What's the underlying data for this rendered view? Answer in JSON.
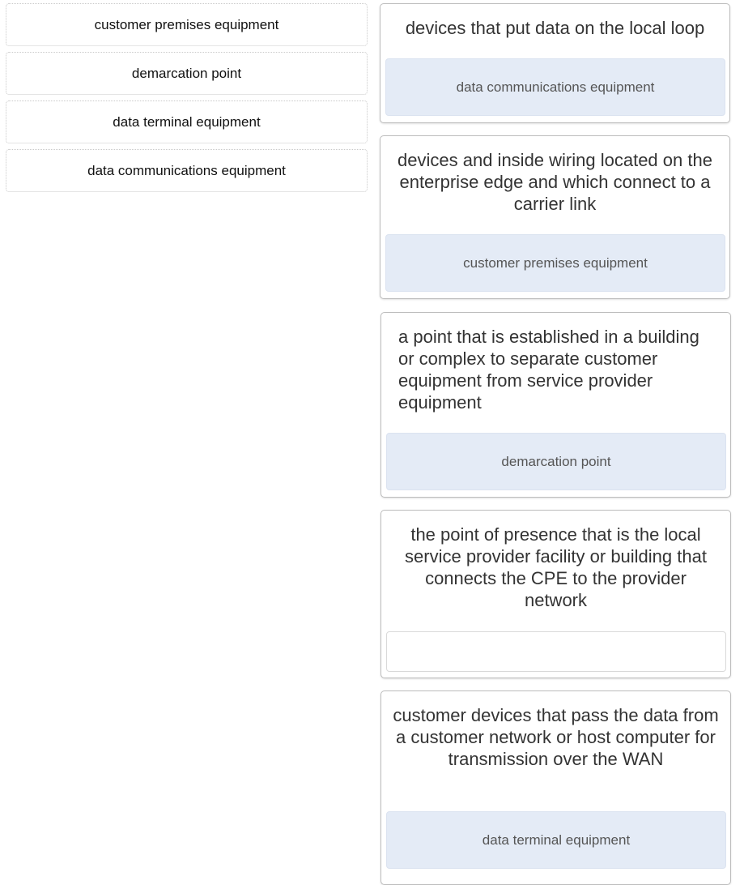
{
  "options": [
    {
      "label": "customer premises equipment"
    },
    {
      "label": "demarcation point"
    },
    {
      "label": "data terminal equipment"
    },
    {
      "label": "data communications equipment"
    }
  ],
  "targets": [
    {
      "description": "devices that put data on the local loop",
      "answer": "data communications equipment"
    },
    {
      "description": "devices and inside wiring located on the enterprise edge and which connect to a carrier link",
      "answer": "customer premises equipment"
    },
    {
      "description": "a point that is established in a building or complex to separate customer equipment from service provider equipment",
      "answer": "demarcation point"
    },
    {
      "description": "the point of presence that is the local service provider facility or building that connects the CPE to the provider network",
      "answer": ""
    },
    {
      "description": "customer devices that pass the data from a customer network or host computer for transmission over the WAN",
      "answer": "data terminal equipment"
    }
  ]
}
